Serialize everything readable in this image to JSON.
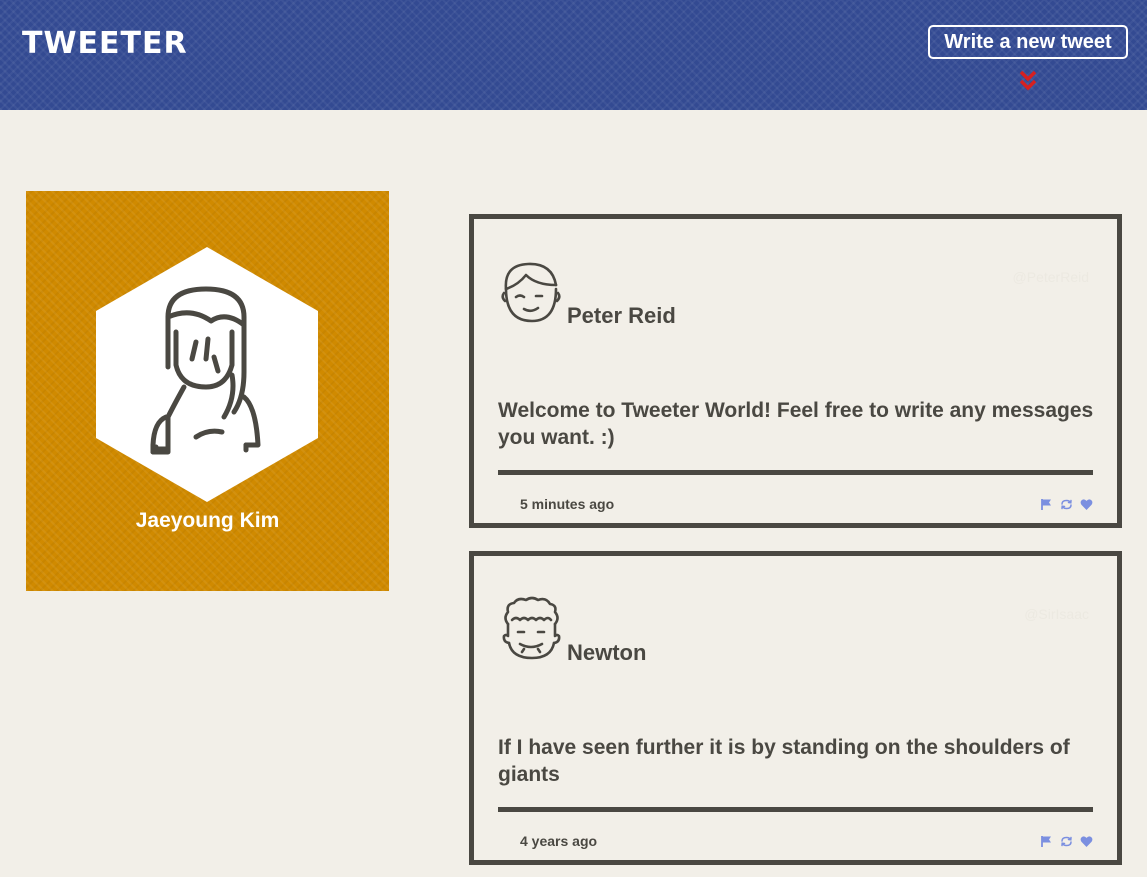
{
  "header": {
    "logo": "TWEETER",
    "compose_label": "Write a new tweet",
    "compose_icon": "double-chevron-down-icon",
    "accent_color": "#d62020"
  },
  "profile": {
    "name": "Jaeyoung Kim",
    "avatar_icon": "woman-avatar-icon",
    "background_color": "#d08a00"
  },
  "tweets": [
    {
      "author": "Peter Reid",
      "handle": "@PeterReid",
      "avatar_icon": "winking-man-avatar-icon",
      "content": "Welcome to Tweeter World! Feel free to write any messages you want. :)",
      "time": "5 minutes ago",
      "actions": [
        "flag-icon",
        "retweet-icon",
        "heart-icon"
      ]
    },
    {
      "author": "Newton",
      "handle": "@SirIsaac",
      "avatar_icon": "curly-hair-man-avatar-icon",
      "content": "If I have seen further it is by standing on the shoulders of giants",
      "time": "4 years ago",
      "actions": [
        "flag-icon",
        "retweet-icon",
        "heart-icon"
      ]
    }
  ],
  "colors": {
    "header": "#334a92",
    "page": "#f2efe8",
    "ink": "#4a4842",
    "action": "#7b8fe0"
  }
}
